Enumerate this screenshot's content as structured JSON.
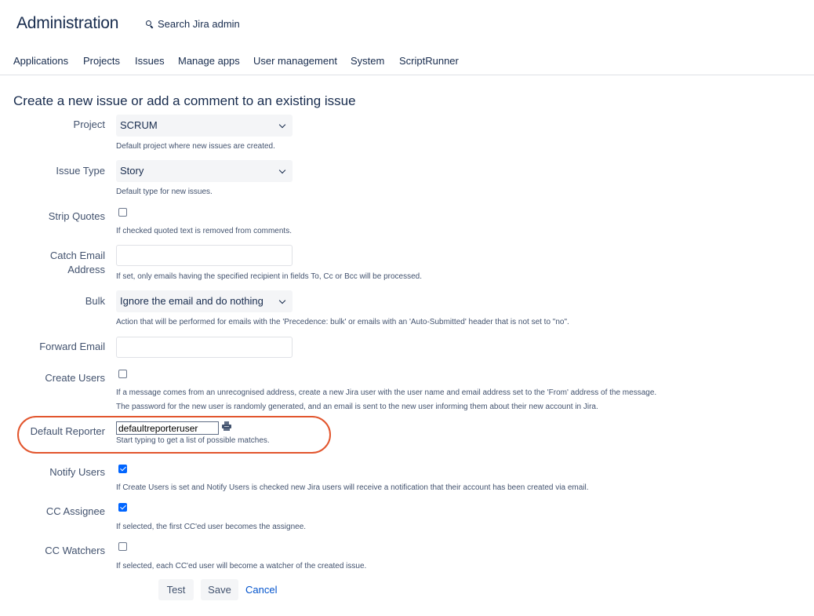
{
  "header": {
    "title": "Administration",
    "search_label": "Search Jira admin"
  },
  "nav": {
    "applications": "Applications",
    "projects": "Projects",
    "issues": "Issues",
    "manage_apps": "Manage apps",
    "user_management": "User management",
    "system": "System",
    "scriptrunner": "ScriptRunner"
  },
  "form": {
    "heading": "Create a new issue or add a comment to an existing issue",
    "project": {
      "label": "Project",
      "value": "SCRUM",
      "help": "Default project where new issues are created."
    },
    "issue_type": {
      "label": "Issue Type",
      "value": "Story",
      "help": "Default type for new issues."
    },
    "strip_quotes": {
      "label": "Strip Quotes",
      "checked": false,
      "help": "If checked quoted text is removed from comments."
    },
    "catch_email": {
      "label_line1": "Catch Email",
      "label_line2": "Address",
      "value": "",
      "help": "If set, only emails having the specified recipient in fields To, Cc or Bcc will be processed."
    },
    "bulk": {
      "label": "Bulk",
      "value": "Ignore the email and do nothing",
      "help": "Action that will be performed for emails with the 'Precedence: bulk' or emails with an 'Auto-Submitted' header that is not set to \"no\"."
    },
    "forward_email": {
      "label": "Forward Email",
      "value": ""
    },
    "create_users": {
      "label": "Create Users",
      "checked": false,
      "help_line1": "If a message comes from an unrecognised address, create a new Jira user with the user name and email address set to the 'From' address of the message.",
      "help_line2": "The password for the new user is randomly generated, and an email is sent to the new user informing them about their new account in Jira."
    },
    "default_reporter": {
      "label": "Default Reporter",
      "value": "defaultreporteruser",
      "help": "Start typing to get a list of possible matches."
    },
    "notify_users": {
      "label": "Notify Users",
      "checked": true,
      "help": "If Create Users is set and Notify Users is checked new Jira users will receive a notification that their account has been created via email."
    },
    "cc_assignee": {
      "label": "CC Assignee",
      "checked": true,
      "help": "If selected, the first CC'ed user becomes the assignee."
    },
    "cc_watchers": {
      "label": "CC Watchers",
      "checked": false,
      "help": "If selected, each CC'ed user will become a watcher of the created issue."
    }
  },
  "buttons": {
    "test": "Test",
    "save": "Save",
    "cancel": "Cancel"
  },
  "colors": {
    "highlight": "#e2552d",
    "checkbox_checked": "#0065ff",
    "link": "#0052cc"
  },
  "icons": {
    "search": "search-icon",
    "user_picker": "user-picker-icon",
    "select_chevron": "chevron-down-icon"
  }
}
